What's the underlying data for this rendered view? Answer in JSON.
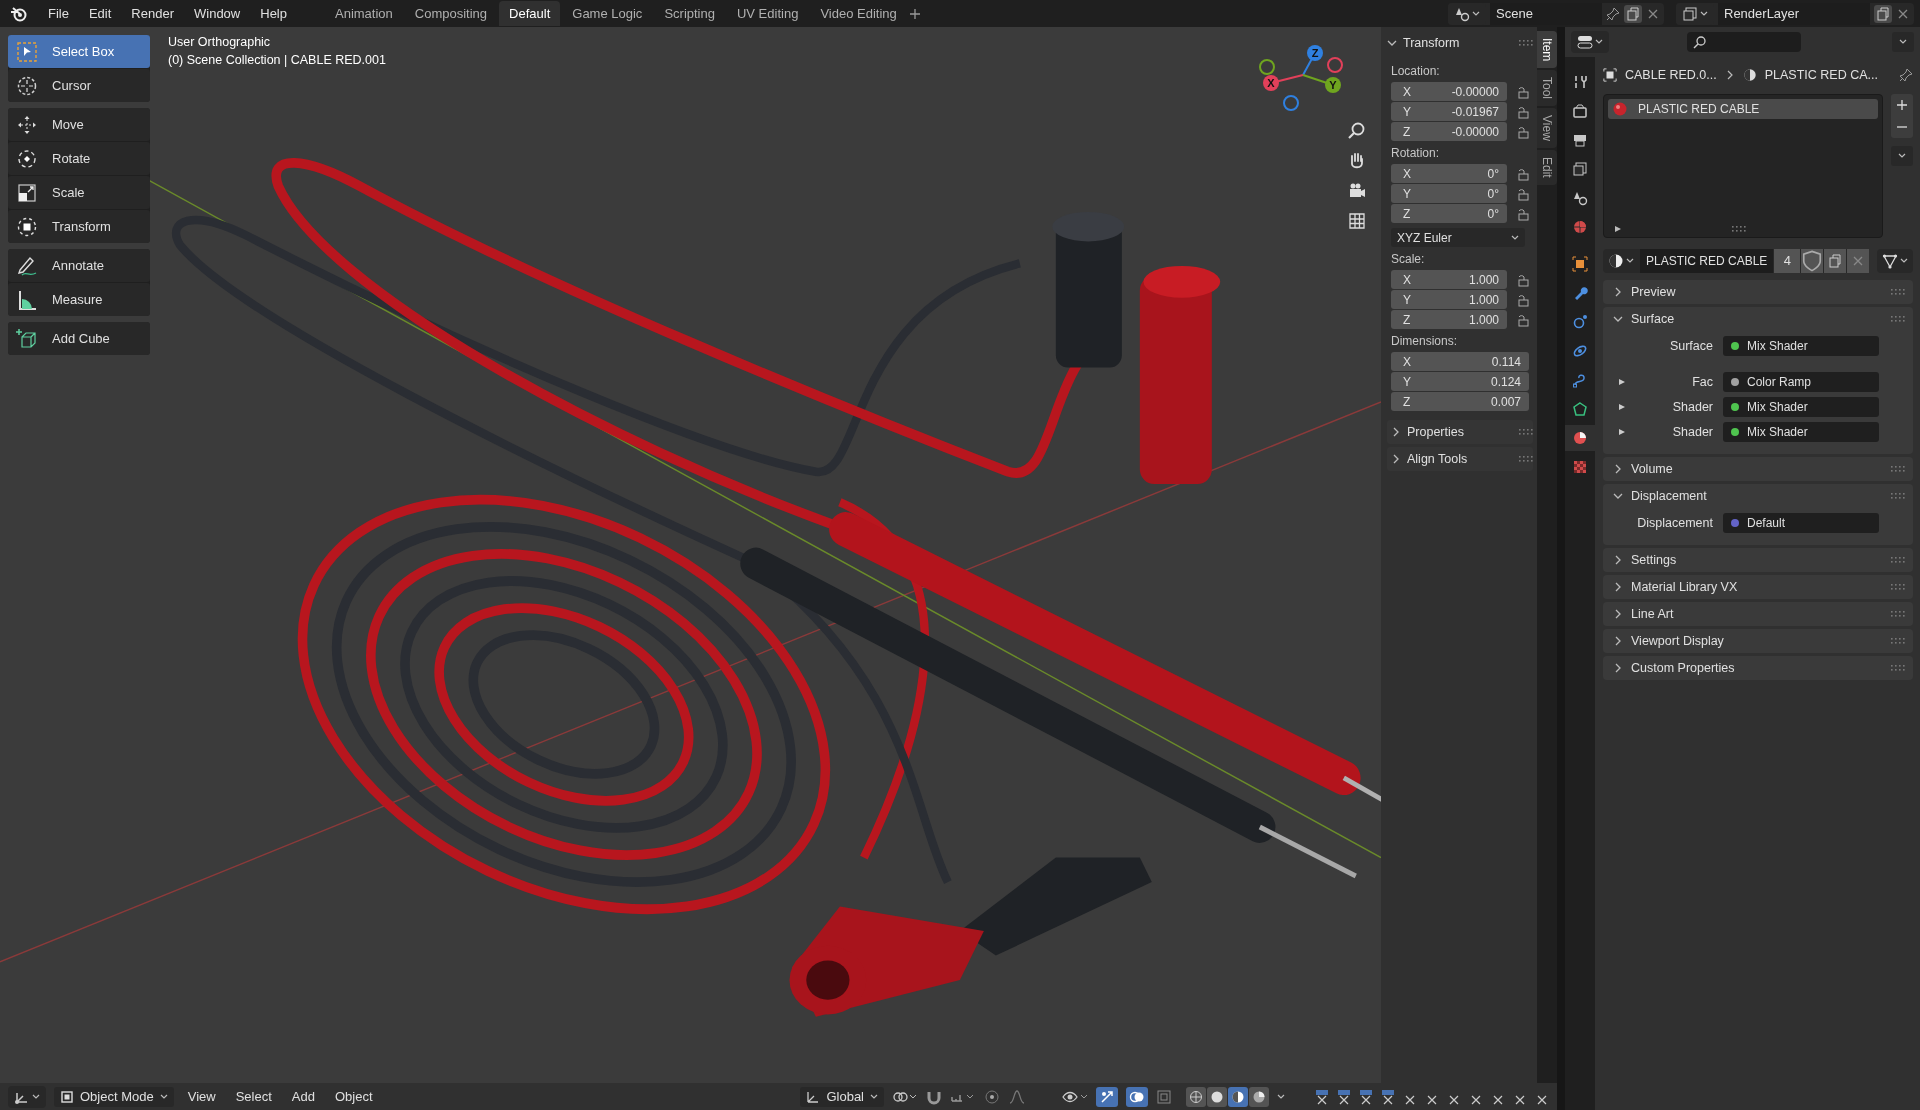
{
  "menu": [
    "File",
    "Edit",
    "Render",
    "Window",
    "Help"
  ],
  "workspaces": [
    {
      "label": "Animation",
      "selected": false
    },
    {
      "label": "Compositing",
      "selected": false
    },
    {
      "label": "Default",
      "selected": true
    },
    {
      "label": "Game Logic",
      "selected": false
    },
    {
      "label": "Scripting",
      "selected": false
    },
    {
      "label": "UV Editing",
      "selected": false
    },
    {
      "label": "Video Editing",
      "selected": false
    }
  ],
  "scene": {
    "name": "Scene"
  },
  "view_layer": {
    "name": "RenderLayer"
  },
  "toolbar": [
    [
      {
        "kind": "select-box",
        "label": "Select Box",
        "selected": true
      },
      {
        "kind": "cursor",
        "label": "Cursor",
        "selected": false
      }
    ],
    [
      {
        "kind": "move",
        "label": "Move",
        "selected": false
      },
      {
        "kind": "rotate",
        "label": "Rotate",
        "selected": false
      },
      {
        "kind": "scale",
        "label": "Scale",
        "selected": false
      },
      {
        "kind": "transform",
        "label": "Transform",
        "selected": false
      }
    ],
    [
      {
        "kind": "annotate",
        "label": "Annotate",
        "selected": false
      },
      {
        "kind": "measure",
        "label": "Measure",
        "selected": false
      }
    ],
    [
      {
        "kind": "add-cube",
        "label": "Add Cube",
        "selected": false
      }
    ]
  ],
  "viewport": {
    "view_name": "User Orthographic",
    "collection_info": "(0) Scene Collection | CABLE RED.001"
  },
  "gizmo_axes": [
    {
      "label": "Z",
      "color": "#2f80e0"
    },
    {
      "label": "X",
      "color": "#e2405a"
    },
    {
      "label": "Y",
      "color": "#6fa51f"
    }
  ],
  "sidebar_tabs": [
    {
      "label": "Item",
      "selected": true
    },
    {
      "label": "Tool",
      "selected": false
    },
    {
      "label": "View",
      "selected": false
    },
    {
      "label": "Edit",
      "selected": false
    }
  ],
  "transform": {
    "title": "Transform",
    "expanded": true,
    "groups": [
      {
        "label": "Location:",
        "lockable": true,
        "fields": [
          {
            "axis": "X",
            "value": "-0.00000"
          },
          {
            "axis": "Y",
            "value": "-0.01967"
          },
          {
            "axis": "Z",
            "value": "-0.00000"
          }
        ]
      },
      {
        "label": "Rotation:",
        "lockable": true,
        "fields": [
          {
            "axis": "X",
            "value": "0°"
          },
          {
            "axis": "Y",
            "value": "0°"
          },
          {
            "axis": "Z",
            "value": "0°"
          }
        ],
        "mode": "XYZ Euler"
      },
      {
        "label": "Scale:",
        "lockable": true,
        "fields": [
          {
            "axis": "X",
            "value": "1.000"
          },
          {
            "axis": "Y",
            "value": "1.000"
          },
          {
            "axis": "Z",
            "value": "1.000"
          }
        ]
      },
      {
        "label": "Dimensions:",
        "lockable": false,
        "fields": [
          {
            "axis": "X",
            "value": "0.114"
          },
          {
            "axis": "Y",
            "value": "0.124"
          },
          {
            "axis": "Z",
            "value": "0.007"
          }
        ]
      }
    ]
  },
  "sidebar_panels": [
    {
      "title": "Properties",
      "expanded": false
    },
    {
      "title": "Align Tools",
      "expanded": false
    }
  ],
  "properties": {
    "tabs": [
      {
        "kind": "tool",
        "selected": false
      },
      {
        "kind": "render",
        "selected": false
      },
      {
        "kind": "output",
        "selected": false
      },
      {
        "kind": "view-layer",
        "selected": false
      },
      {
        "kind": "scene",
        "selected": false
      },
      {
        "kind": "world",
        "selected": false
      },
      {
        "kind": "object",
        "selected": false
      },
      {
        "kind": "modifiers",
        "selected": false
      },
      {
        "kind": "particles",
        "selected": false
      },
      {
        "kind": "physics",
        "selected": false
      },
      {
        "kind": "constraints",
        "selected": false
      },
      {
        "kind": "data",
        "selected": false
      },
      {
        "kind": "material",
        "selected": true
      },
      {
        "kind": "texture",
        "selected": false
      }
    ],
    "breadcrumb": [
      "CABLE RED.0...",
      "PLASTIC RED CA..."
    ],
    "slots": [
      {
        "name": "PLASTIC RED CABLE",
        "selected": true
      }
    ],
    "material": {
      "name": "PLASTIC RED CABLE",
      "users": "4"
    },
    "panels": [
      {
        "title": "Preview",
        "expanded": false
      },
      {
        "title": "Surface",
        "expanded": true,
        "rows": [
          {
            "label": "Surface",
            "value": "Mix Shader",
            "color": "#4fc44f",
            "expandable": false
          },
          {
            "label": "Fac",
            "value": "Color Ramp",
            "color": "#a1a1a1",
            "expandable": true
          },
          {
            "label": "Shader",
            "value": "Mix Shader",
            "color": "#4fc44f",
            "expandable": true
          },
          {
            "label": "Shader",
            "value": "Mix Shader",
            "color": "#4fc44f",
            "expandable": true
          }
        ]
      },
      {
        "title": "Volume",
        "expanded": false
      },
      {
        "title": "Displacement",
        "expanded": true,
        "rows": [
          {
            "label": "Displacement",
            "value": "Default",
            "color": "#6363c7",
            "expandable": false
          }
        ]
      },
      {
        "title": "Settings",
        "expanded": false
      },
      {
        "title": "Material Library VX",
        "expanded": false
      },
      {
        "title": "Line Art",
        "expanded": false
      },
      {
        "title": "Viewport Display",
        "expanded": false
      },
      {
        "title": "Custom Properties",
        "expanded": false
      }
    ]
  },
  "header": {
    "mode": "Object Mode",
    "menus": [
      "View",
      "Select",
      "Add",
      "Object"
    ],
    "orientation": "Global",
    "shading_modes": [
      {
        "kind": "wireframe",
        "selected": false
      },
      {
        "kind": "solid",
        "selected": false
      },
      {
        "kind": "material",
        "selected": true
      },
      {
        "kind": "rendered",
        "selected": false
      }
    ]
  }
}
